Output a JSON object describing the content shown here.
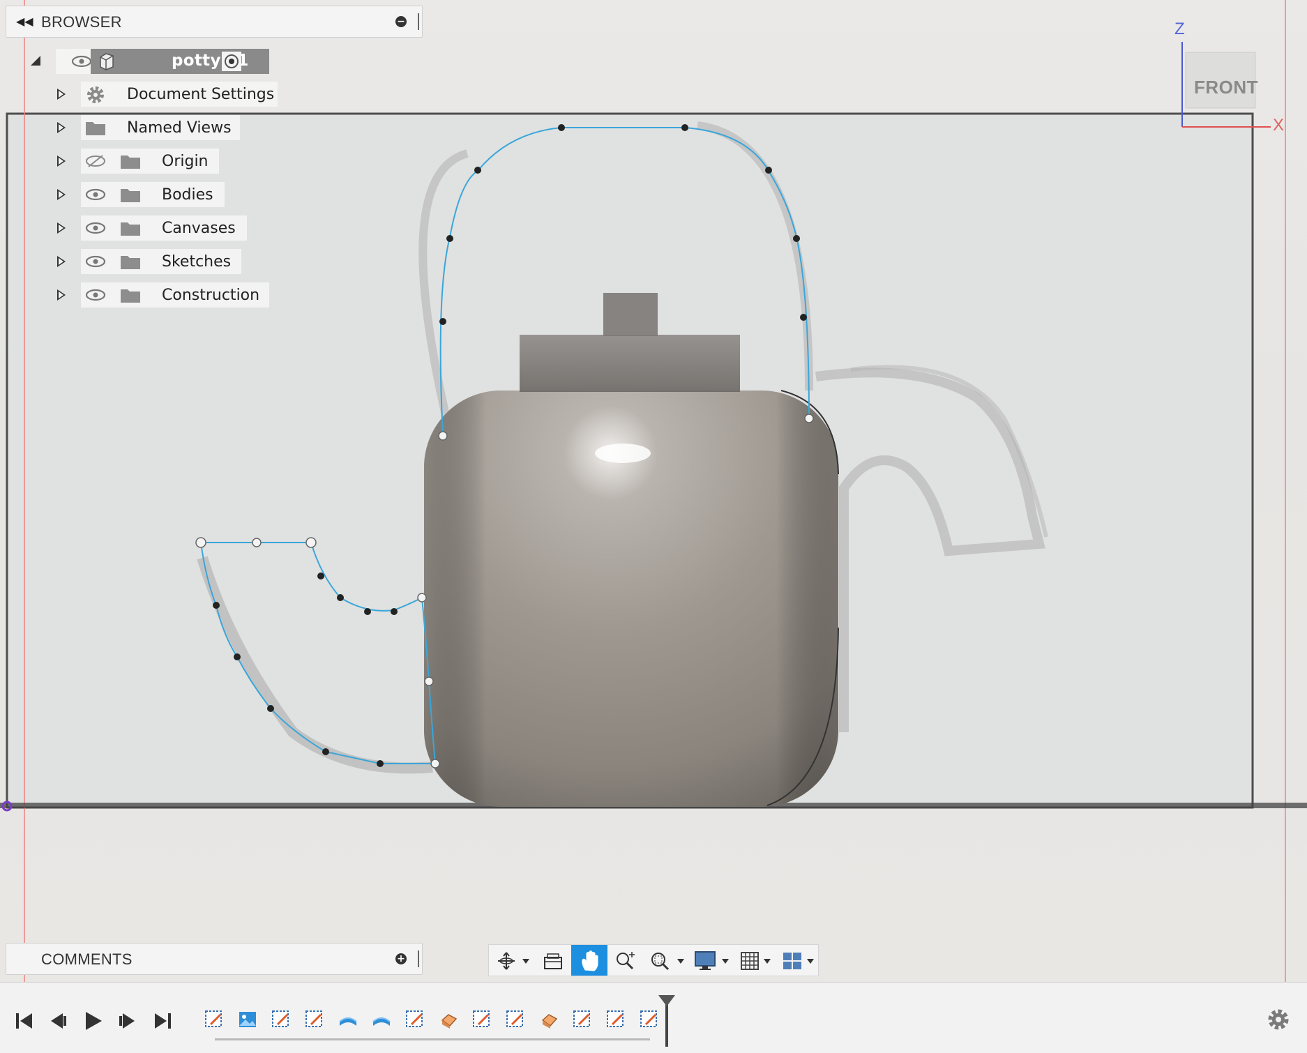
{
  "browser": {
    "title": "BROWSER",
    "root": {
      "label": "potty v1"
    },
    "items": [
      {
        "label": "Document Settings",
        "icon": "gear-icon"
      },
      {
        "label": "Named Views",
        "icon": "folder-icon"
      },
      {
        "label": "Origin",
        "icon": "folder-icon",
        "visibility": "hidden-eye-icon"
      },
      {
        "label": "Bodies",
        "icon": "folder-icon",
        "visibility": "eye-icon"
      },
      {
        "label": "Canvases",
        "icon": "folder-icon",
        "visibility": "eye-icon"
      },
      {
        "label": "Sketches",
        "icon": "folder-icon",
        "visibility": "eye-icon"
      },
      {
        "label": "Construction",
        "icon": "folder-icon",
        "visibility": "eye-icon"
      }
    ]
  },
  "viewcube": {
    "face": "FRONT",
    "axis_z": "Z",
    "axis_x": "X"
  },
  "comments": {
    "title": "COMMENTS"
  },
  "nav_toolbar": {
    "buttons": [
      "orbit-icon",
      "look-at-icon",
      "pan-icon",
      "zoom-icon",
      "fit-icon",
      "display-settings-icon",
      "grid-icon",
      "viewports-icon"
    ],
    "active": "pan-icon"
  },
  "timeline": {
    "playback": [
      "first-icon",
      "previous-icon",
      "play-icon",
      "next-icon",
      "last-icon"
    ],
    "features": [
      "sketch",
      "canvas",
      "sketch",
      "sketch",
      "revolve",
      "revolve",
      "sketch",
      "extrude",
      "sketch",
      "sketch",
      "extrude",
      "sketch",
      "sketch",
      "sketch"
    ]
  },
  "colors": {
    "accent": "#1d8fe0",
    "sketch_curve": "#3aa6d9",
    "panel": "#f4f4f4"
  }
}
